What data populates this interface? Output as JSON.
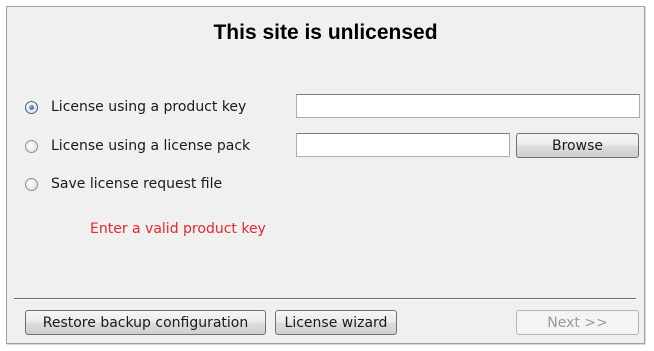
{
  "window": {
    "title": "This site is unlicensed"
  },
  "options": {
    "product_key": {
      "label": "License using a product key",
      "selected": true,
      "input_value": ""
    },
    "license_pack": {
      "label": "License using a license pack",
      "selected": false,
      "input_value": "",
      "browse_label": "Browse"
    },
    "request_file": {
      "label": "Save license request file",
      "selected": false
    }
  },
  "validation": {
    "message": "Enter a valid product key",
    "color": "#e8262b"
  },
  "footer": {
    "restore_label": "Restore backup configuration",
    "wizard_label": "License wizard",
    "next_label": "Next >>",
    "next_enabled": false
  }
}
